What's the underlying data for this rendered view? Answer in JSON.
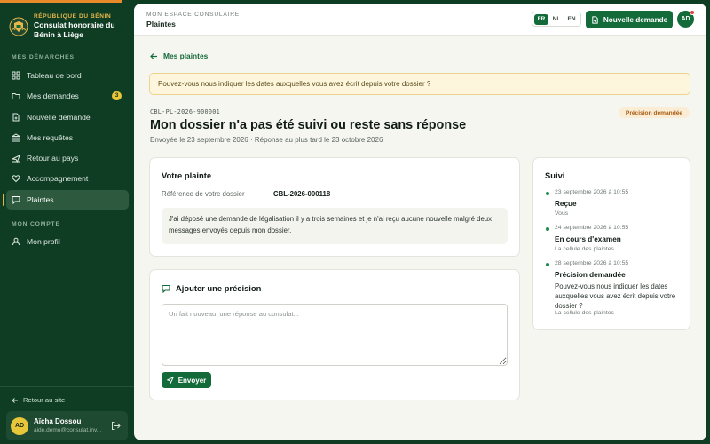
{
  "brand": {
    "kicker": "RÉPUBLIQUE DU BÉNIN",
    "name_line1": "Consulat honoraire du",
    "name_line2": "Bénin à Liège"
  },
  "sidebar": {
    "section_demarches": "MES DÉMARCHES",
    "items": [
      {
        "label": "Tableau de bord",
        "icon": "grid-icon"
      },
      {
        "label": "Mes demandes",
        "icon": "folder-icon",
        "badge": "3"
      },
      {
        "label": "Nouvelle demande",
        "icon": "file-plus-icon"
      },
      {
        "label": "Mes requêtes",
        "icon": "bank-icon"
      },
      {
        "label": "Retour au pays",
        "icon": "plane-icon"
      },
      {
        "label": "Accompagnement",
        "icon": "heart-handshake-icon"
      },
      {
        "label": "Plaintes",
        "icon": "message-square-icon",
        "active": true
      }
    ],
    "section_compte": "MON COMPTE",
    "account_items": [
      {
        "label": "Mon profil",
        "icon": "user-icon"
      }
    ],
    "back_to_site": "Retour au site"
  },
  "user": {
    "initials": "AD",
    "name": "Aïcha Dossou",
    "email": "aide.demo@consulat.inv..."
  },
  "header": {
    "crumb": "MON ESPACE CONSULAIRE",
    "title": "Plaintes",
    "languages": [
      "FR",
      "NL",
      "EN"
    ],
    "active_language": "FR",
    "new_request_label": "Nouvelle demande",
    "avatar_initials": "AD"
  },
  "page": {
    "back_label": "Mes plaintes",
    "alert": "Pouvez-vous nous indiquer les dates auxquelles vous avez écrit depuis votre dossier ?",
    "reference": "CBL-PL-2026-900001",
    "status": "Précision demandée",
    "title": "Mon dossier n'a pas été suivi ou reste sans réponse",
    "subtitle": "Envoyée le 23 septembre 2026 · Réponse au plus tard le 23 octobre 2026"
  },
  "complaint": {
    "title": "Votre plainte",
    "ref_label": "Référence de votre dossier",
    "ref_value": "CBL-2026-000118",
    "message": "J'ai déposé une demande de légalisation il y a trois semaines et je n'ai reçu aucune nouvelle malgré deux messages envoyés depuis mon dossier."
  },
  "precision": {
    "title": "Ajouter une précision",
    "placeholder": "Un fait nouveau, une réponse au consulat...",
    "value": "",
    "send_label": "Envoyer"
  },
  "timeline": {
    "title": "Suivi",
    "events": [
      {
        "date": "23 septembre 2026 à 10:55",
        "title": "Reçue",
        "text": "",
        "by": "Vous"
      },
      {
        "date": "24 septembre 2026 à 10:55",
        "title": "En cours d'examen",
        "text": "",
        "by": "La cellule des plaintes"
      },
      {
        "date": "28 septembre 2026 à 10:55",
        "title": "Précision demandée",
        "text": "Pouvez-vous nous indiquer les dates auxquelles vous avez écrit depuis votre dossier ?",
        "by": "La cellule des plaintes"
      }
    ]
  },
  "colors": {
    "sidebar_bg": "#0f3d24",
    "primary_green": "#146b3a",
    "gold": "#e8b74a",
    "badge_yellow": "#e8c63a",
    "status_orange": "#a85d12",
    "alert_bg": "#fdf6dc"
  }
}
